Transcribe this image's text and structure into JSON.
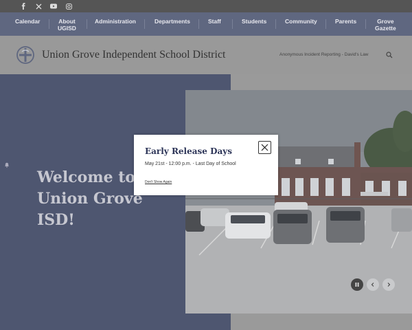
{
  "social": {
    "icons": [
      "facebook-icon",
      "x-icon",
      "youtube-icon",
      "instagram-icon"
    ]
  },
  "nav": {
    "calendar": "Calendar",
    "about_1": "About",
    "about_2": "UGISD",
    "administration": "Administration",
    "departments": "Departments",
    "staff": "Staff",
    "students": "Students",
    "community": "Community",
    "parents": "Parents",
    "gazette_1": "Grove",
    "gazette_2": "Gazette"
  },
  "header": {
    "site_title": "Union Grove Independent School District",
    "report_link": "Anonymous Incident Reporting - David's Law"
  },
  "hero": {
    "welcome_line1": "Welcome to",
    "welcome_line2": "Union Grove",
    "welcome_line3": "ISD!"
  },
  "modal": {
    "title": "Early Release Days",
    "body": "May 21st - 12:00 p.m. - Last Day of School",
    "dismiss": "Don't Show Again"
  },
  "colors": {
    "nav_bg": "#5f6780",
    "hero_left": "#4e5670",
    "modal_title": "#2d3558"
  }
}
